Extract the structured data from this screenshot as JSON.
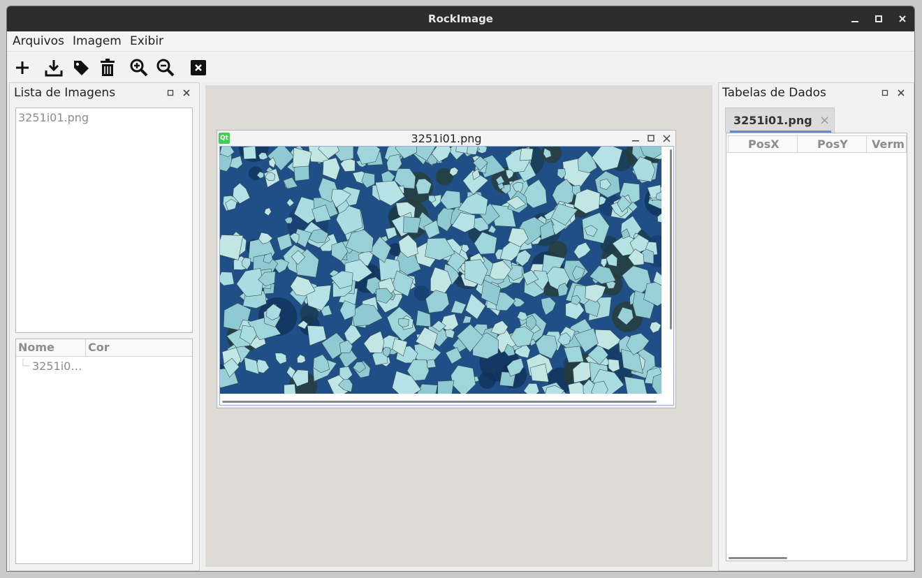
{
  "window": {
    "title": "RockImage"
  },
  "menu": {
    "items": [
      "Arquivos",
      "Imagem",
      "Exibir"
    ]
  },
  "toolbar": {
    "icons": [
      "add-icon",
      "download-icon",
      "tag-icon",
      "trash-icon",
      "zoom-in-icon",
      "zoom-out-icon",
      "close-image-icon"
    ]
  },
  "left_dock": {
    "title": "Lista de Imagens",
    "images": [
      "3251i01.png"
    ],
    "tree": {
      "columns": [
        "Nome",
        "Cor"
      ],
      "rows": [
        {
          "name": "3251i0…"
        }
      ]
    }
  },
  "center": {
    "subwindow": {
      "title": "3251i01.png",
      "logo": "Qt"
    }
  },
  "right_dock": {
    "title": "Tabelas de Dados",
    "tab": {
      "label": "3251i01.png",
      "close": "×"
    },
    "table": {
      "columns": [
        "PosX",
        "PosY",
        "Verm"
      ]
    }
  },
  "colors": {
    "titlebar": "#2c2c2c",
    "accent": "#5b8fd6",
    "mdi_background": "#dedbd7",
    "qt_green": "#41cd52"
  }
}
